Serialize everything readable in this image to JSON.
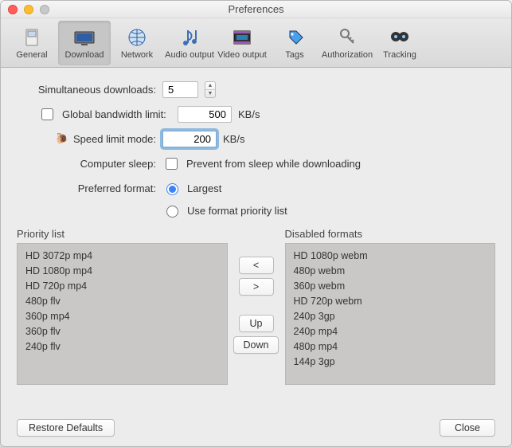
{
  "window": {
    "title": "Preferences"
  },
  "toolbar": {
    "items": [
      {
        "label": "General"
      },
      {
        "label": "Download"
      },
      {
        "label": "Network"
      },
      {
        "label": "Audio output"
      },
      {
        "label": "Video output"
      },
      {
        "label": "Tags"
      },
      {
        "label": "Authorization"
      },
      {
        "label": "Tracking"
      }
    ],
    "active_index": 1
  },
  "form": {
    "simultaneous_label": "Simultaneous downloads:",
    "simultaneous_value": "5",
    "global_bw_label": "Global bandwidth limit:",
    "global_bw_value": "500",
    "speed_limit_label": "Speed limit mode:",
    "speed_limit_value": "200",
    "kbps": "KB/s",
    "computer_sleep_label": "Computer sleep:",
    "prevent_sleep_label": "Prevent from sleep while downloading",
    "preferred_format_label": "Preferred format:",
    "opt_largest": "Largest",
    "opt_priority": "Use format priority list"
  },
  "lists": {
    "priority_title": "Priority list",
    "priority_items": [
      "HD 3072p mp4",
      "HD 1080p mp4",
      "HD 720p mp4",
      "480p flv",
      "360p mp4",
      "360p flv",
      "240p flv"
    ],
    "disabled_title": "Disabled formats",
    "disabled_items": [
      "HD 1080p webm",
      "480p webm",
      "360p webm",
      "HD 720p webm",
      "240p 3gp",
      "240p mp4",
      "480p mp4",
      "144p 3gp"
    ],
    "btn_left": "<",
    "btn_right": ">",
    "btn_up": "Up",
    "btn_down": "Down"
  },
  "footer": {
    "restore": "Restore Defaults",
    "close": "Close"
  }
}
